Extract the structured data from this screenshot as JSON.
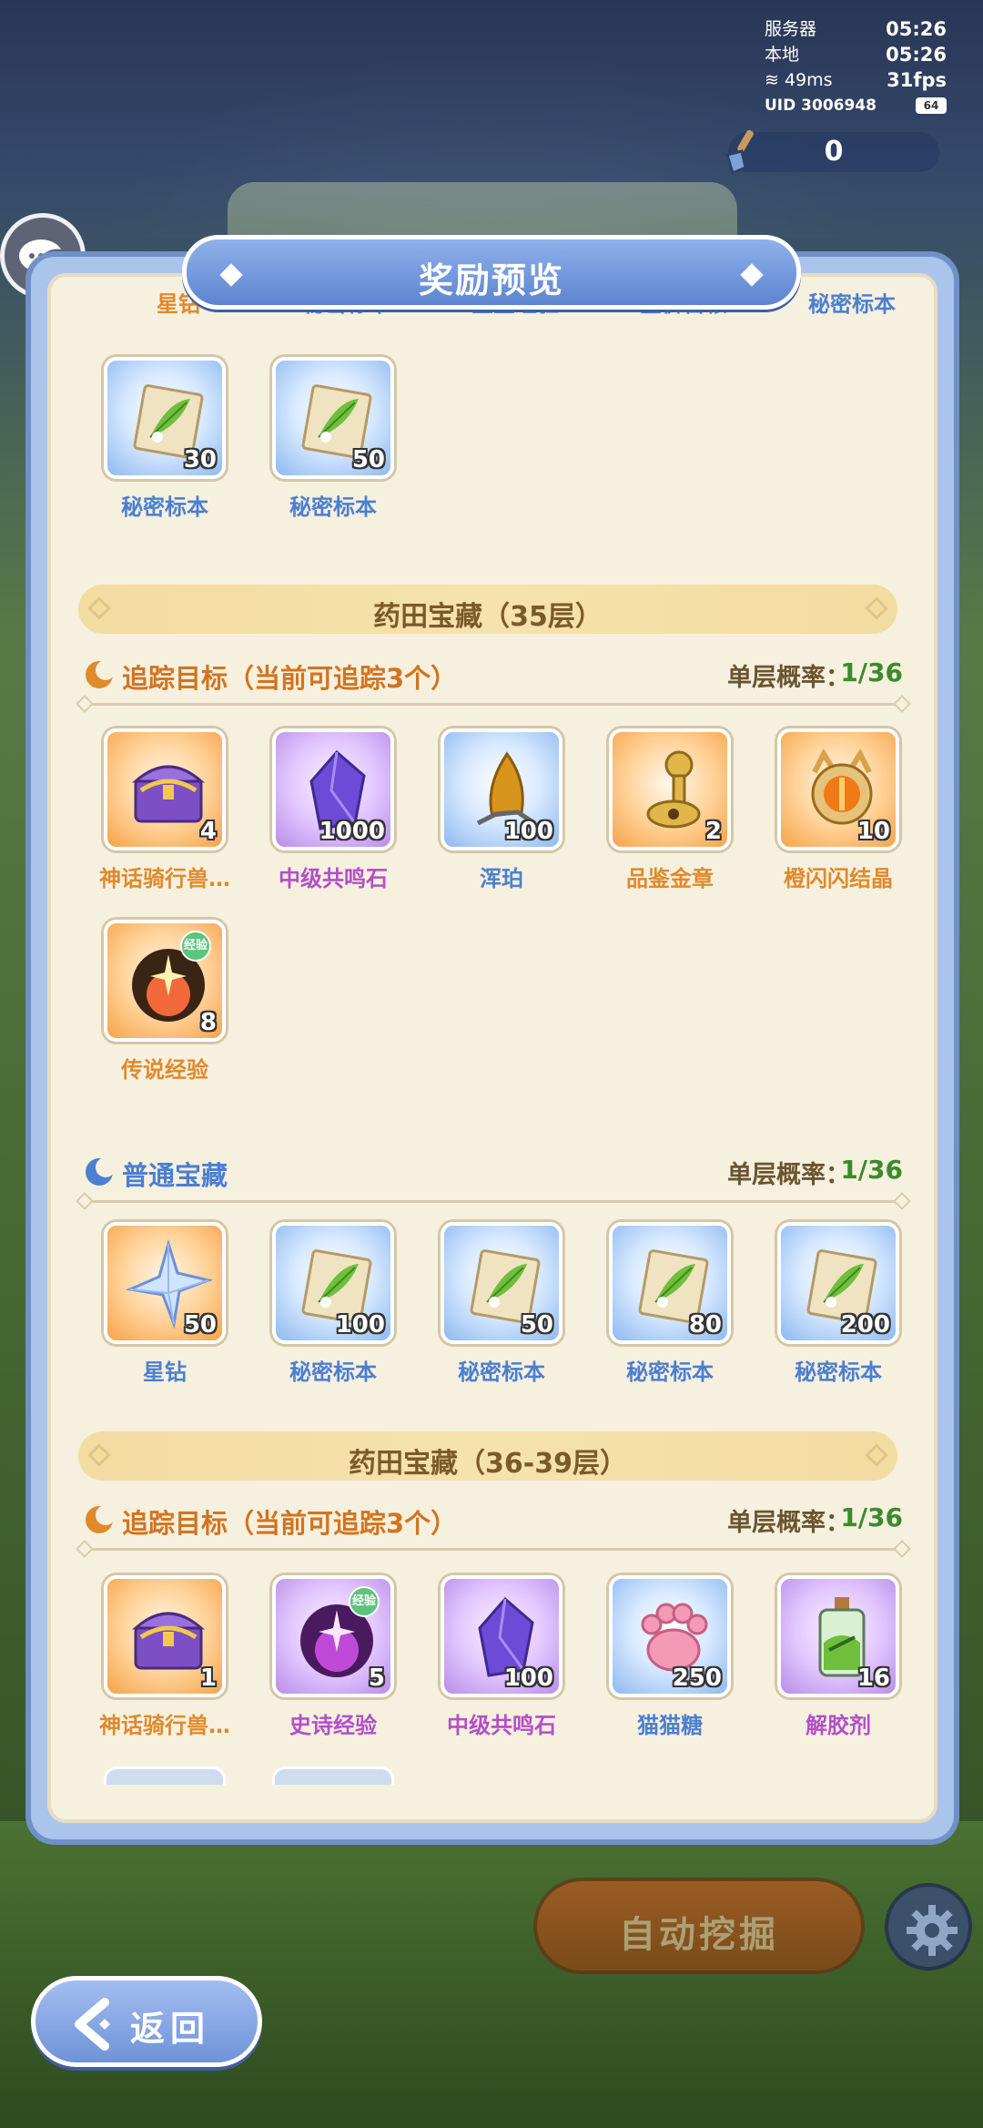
{
  "hud": {
    "server_label": "服务器",
    "server_time": "05:26",
    "local_label": "本地",
    "local_time": "05:26",
    "ping": "49ms",
    "fps": "31fps",
    "uid": "UID 3006948",
    "battery": "64"
  },
  "counter": {
    "value": "0"
  },
  "modal": {
    "title": "奖励预览",
    "top_partial_labels": [
      "星钻",
      "秘密标本",
      "星星经验",
      "全价兽粮",
      "秘密标本"
    ],
    "top_items": [
      {
        "name": "秘密标本",
        "qty": "30",
        "rarity": "blue",
        "icon": "leaf-card-icon"
      },
      {
        "name": "秘密标本",
        "qty": "50",
        "rarity": "blue",
        "icon": "leaf-card-icon"
      }
    ],
    "section1": {
      "title": "药田宝藏（35层）",
      "group1": {
        "name": "追踪目标（当前可追踪3个）",
        "rate_label": "单层概率：",
        "rate": "1/36",
        "items": [
          {
            "name": "神话骑行兽…",
            "qty": "4",
            "rarity": "orange",
            "icon": "treasure-chest-icon"
          },
          {
            "name": "中级共鸣石",
            "qty": "1000",
            "rarity": "purple",
            "icon": "purple-crystal-icon"
          },
          {
            "name": "浑珀",
            "qty": "100",
            "rarity": "blue",
            "icon": "amber-icon"
          },
          {
            "name": "品鉴金章",
            "qty": "2",
            "rarity": "orange",
            "icon": "gold-seal-icon"
          },
          {
            "name": "橙闪闪结晶",
            "qty": "10",
            "rarity": "orange",
            "icon": "orange-orb-icon"
          },
          {
            "name": "传说经验",
            "qty": "8",
            "rarity": "orange",
            "icon": "legend-exp-icon",
            "badge": "经验"
          }
        ]
      },
      "group2": {
        "name": "普通宝藏",
        "rate_label": "单层概率：",
        "rate": "1/36",
        "items": [
          {
            "name": "星钻",
            "qty": "50",
            "rarity": "orange",
            "icon": "star-diamond-icon"
          },
          {
            "name": "秘密标本",
            "qty": "100",
            "rarity": "blue",
            "icon": "leaf-card-icon"
          },
          {
            "name": "秘密标本",
            "qty": "50",
            "rarity": "blue",
            "icon": "leaf-card-icon"
          },
          {
            "name": "秘密标本",
            "qty": "80",
            "rarity": "blue",
            "icon": "leaf-card-icon"
          },
          {
            "name": "秘密标本",
            "qty": "200",
            "rarity": "blue",
            "icon": "leaf-card-icon"
          }
        ]
      }
    },
    "section2": {
      "title": "药田宝藏（36-39层）",
      "group1": {
        "name": "追踪目标（当前可追踪3个）",
        "rate_label": "单层概率：",
        "rate": "1/36",
        "items": [
          {
            "name": "神话骑行兽…",
            "qty": "1",
            "rarity": "orange",
            "icon": "treasure-chest-icon"
          },
          {
            "name": "史诗经验",
            "qty": "5",
            "rarity": "purple",
            "icon": "epic-exp-icon",
            "badge": "经验"
          },
          {
            "name": "中级共鸣石",
            "qty": "100",
            "rarity": "purple",
            "icon": "purple-crystal-icon"
          },
          {
            "name": "猫猫糖",
            "qty": "250",
            "rarity": "blue",
            "icon": "paw-candy-icon"
          },
          {
            "name": "解胶剂",
            "qty": "16",
            "rarity": "purple",
            "icon": "potion-bottle-icon"
          }
        ]
      }
    }
  },
  "buttons": {
    "auto_dig": "自动挖掘",
    "back": "返回"
  },
  "colors": {
    "rate_green": "#3b8a2c",
    "label_blue": "#4b7fd0",
    "label_orange": "#e08a2c",
    "label_purple": "#b24fc9",
    "modal_blue": "#7090c8"
  }
}
